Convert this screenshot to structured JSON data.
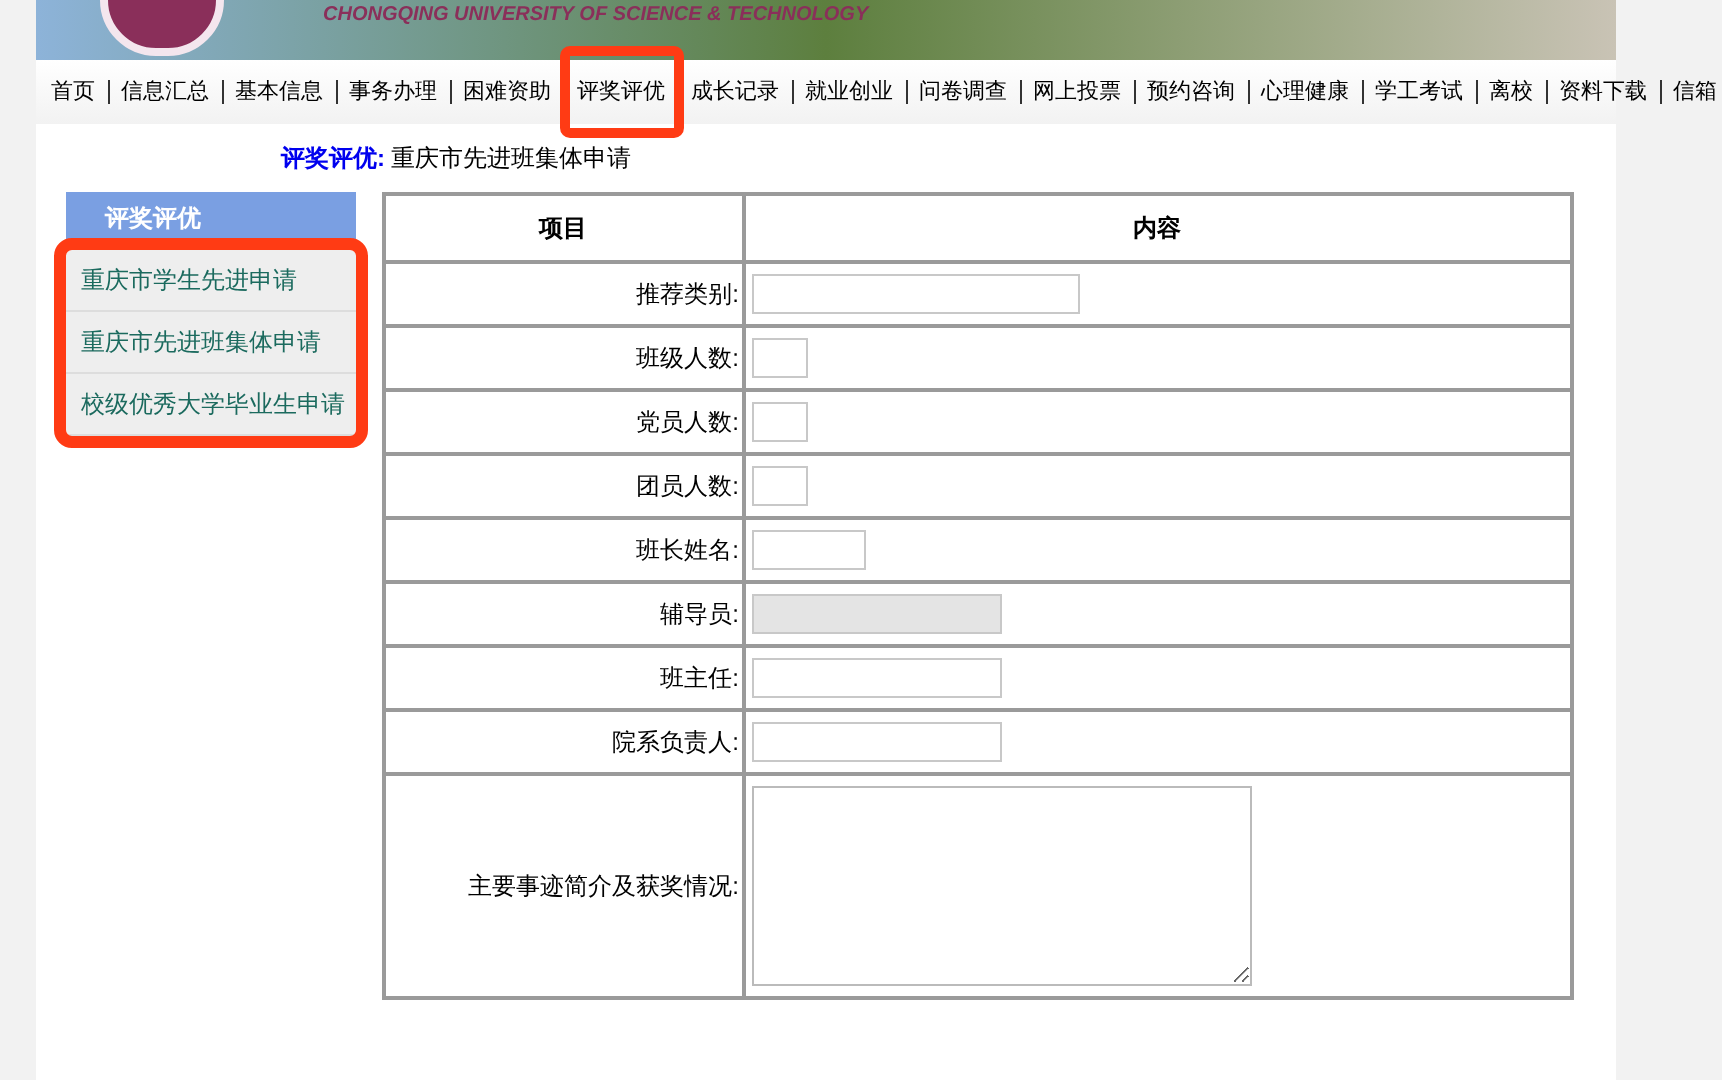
{
  "banner": {
    "title": "CHONGQING UNIVERSITY OF SCIENCE & TECHNOLOGY"
  },
  "nav": [
    {
      "label": "首页",
      "highlighted": false
    },
    {
      "label": "信息汇总",
      "highlighted": false
    },
    {
      "label": "基本信息",
      "highlighted": false
    },
    {
      "label": "事务办理",
      "highlighted": false
    },
    {
      "label": "困难资助",
      "highlighted": false
    },
    {
      "label": "评奖评优",
      "highlighted": true
    },
    {
      "label": "成长记录",
      "highlighted": false
    },
    {
      "label": "就业创业",
      "highlighted": false
    },
    {
      "label": "问卷调查",
      "highlighted": false
    },
    {
      "label": "网上投票",
      "highlighted": false
    },
    {
      "label": "预约咨询",
      "highlighted": false
    },
    {
      "label": "心理健康",
      "highlighted": false
    },
    {
      "label": "学工考试",
      "highlighted": false
    },
    {
      "label": "离校",
      "highlighted": false
    },
    {
      "label": "资料下载",
      "highlighted": false
    },
    {
      "label": "信箱",
      "highlighted": false
    }
  ],
  "breadcrumb": {
    "section": "评奖评优:",
    "page": "重庆市先进班集体申请"
  },
  "sidebar": {
    "title": "评奖评优",
    "highlighted": true,
    "items": [
      "重庆市学生先进申请",
      "重庆市先进班集体申请",
      "校级优秀大学毕业生申请"
    ]
  },
  "table": {
    "columns": [
      "项目",
      "内容"
    ],
    "rows": [
      {
        "label": "推荐类别:",
        "kind": "long",
        "disabled": false
      },
      {
        "label": "班级人数:",
        "kind": "tiny",
        "disabled": false
      },
      {
        "label": "党员人数:",
        "kind": "tiny",
        "disabled": false
      },
      {
        "label": "团员人数:",
        "kind": "tiny",
        "disabled": false
      },
      {
        "label": "班长姓名:",
        "kind": "short",
        "disabled": false
      },
      {
        "label": "辅导员:",
        "kind": "medium",
        "disabled": true
      },
      {
        "label": "班主任:",
        "kind": "medium",
        "disabled": false
      },
      {
        "label": "院系负责人:",
        "kind": "medium",
        "disabled": false
      },
      {
        "label": "主要事迹简介及获奖情况:",
        "kind": "textarea",
        "disabled": false
      }
    ]
  }
}
